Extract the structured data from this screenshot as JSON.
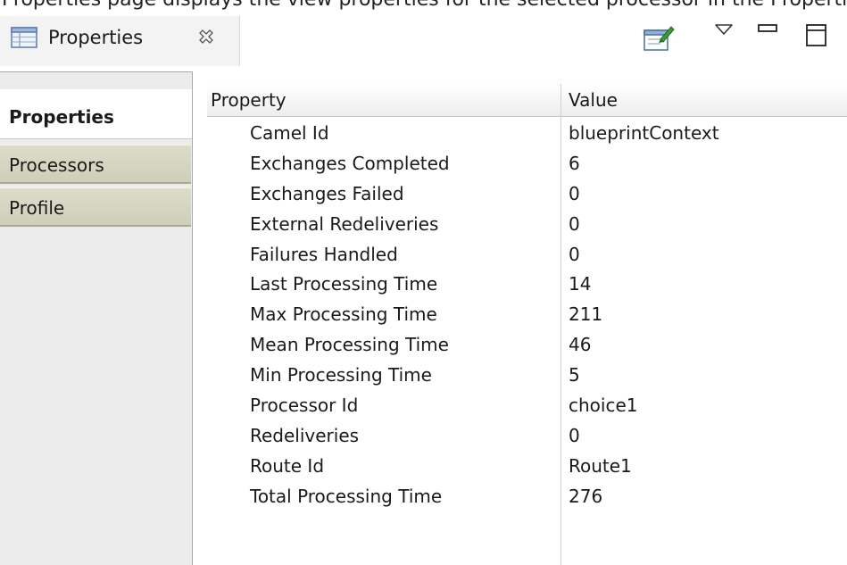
{
  "top_strip_text": "Properties page displays the view properties for the selected processor in the Properties view. The Properties page",
  "view_tab": {
    "title": "Properties",
    "icon": "properties-view-icon",
    "close_icon": "close-x-icon"
  },
  "toolbar": {
    "pin_icon": "pin-to-selection-icon",
    "view_menu_icon": "view-menu-triangle-icon",
    "minimize_icon": "minimize-icon",
    "maximize_icon": "maximize-icon"
  },
  "side_tabs": [
    {
      "label": "Properties",
      "active": true
    },
    {
      "label": "Processors",
      "active": false
    },
    {
      "label": "Profile",
      "active": false
    }
  ],
  "table": {
    "headers": {
      "property": "Property",
      "value": "Value"
    },
    "rows": [
      {
        "property": "Camel Id",
        "value": "blueprintContext"
      },
      {
        "property": "Exchanges Completed",
        "value": "6"
      },
      {
        "property": "Exchanges Failed",
        "value": "0"
      },
      {
        "property": "External Redeliveries",
        "value": "0"
      },
      {
        "property": "Failures Handled",
        "value": "0"
      },
      {
        "property": "Last Processing Time",
        "value": "14"
      },
      {
        "property": "Max Processing Time",
        "value": "211"
      },
      {
        "property": "Mean Processing Time",
        "value": "46"
      },
      {
        "property": "Min Processing Time",
        "value": "5"
      },
      {
        "property": "Processor Id",
        "value": "choice1"
      },
      {
        "property": "Redeliveries",
        "value": "0"
      },
      {
        "property": "Route Id",
        "value": "Route1"
      },
      {
        "property": "Total Processing Time",
        "value": "276"
      }
    ]
  },
  "colors": {
    "side_tab_inactive": "#d5d5c1",
    "panel_background": "#ececec"
  }
}
